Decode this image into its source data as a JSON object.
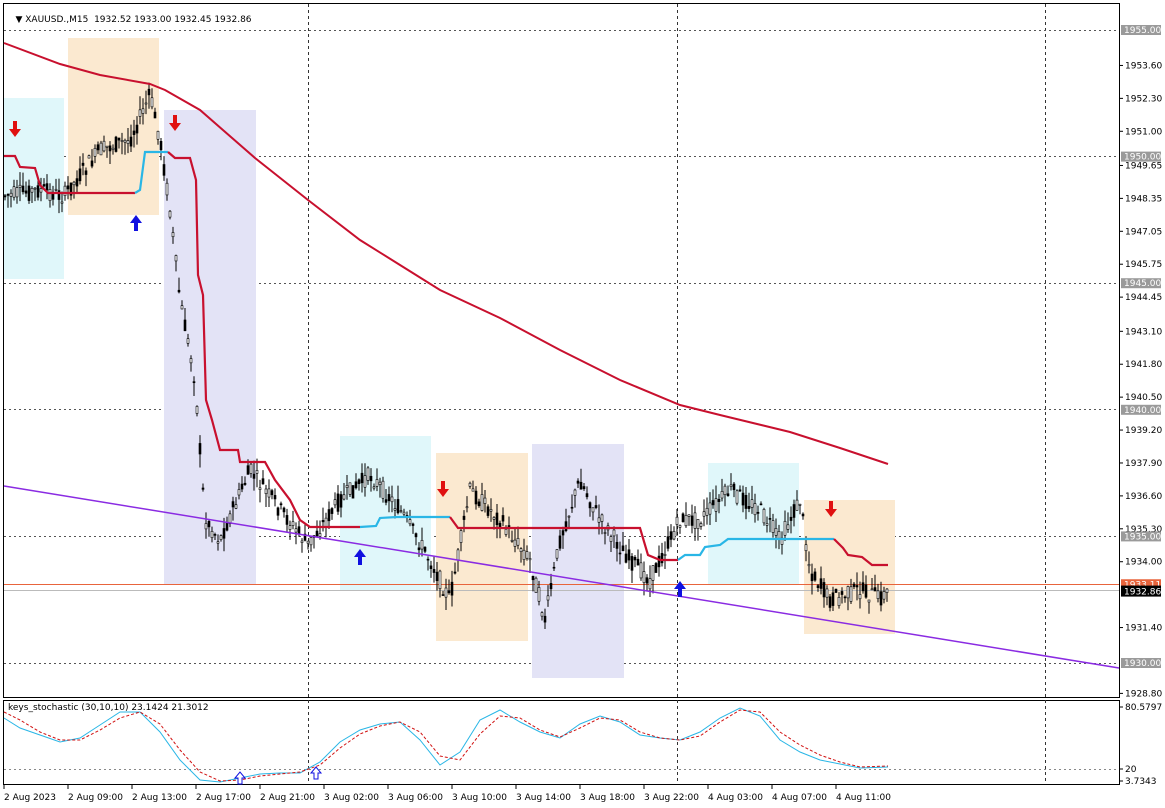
{
  "header": {
    "symbol": "XAUUSD.,M15",
    "ohlc": "1932.52 1933.00 1932.45 1932.86"
  },
  "indicator": {
    "label": "keys_stochastic (30,10,10) 23.1424 21.3012"
  },
  "price_scale": {
    "labels": [
      "1953.60",
      "1952.30",
      "1951.00",
      "1949.65",
      "1948.35",
      "1947.05",
      "1945.75",
      "1944.45",
      "1943.10",
      "1941.80",
      "1940.50",
      "1939.20",
      "1937.90",
      "1936.60",
      "1935.30",
      "1934.00",
      "1931.40",
      "1928.80"
    ],
    "grid_levels": [
      "1955.00",
      "1950.00",
      "1945.00",
      "1940.00",
      "1935.00",
      "1930.00"
    ],
    "current_price": "1932.86",
    "line_price": "1933.11"
  },
  "indicator_scale": {
    "top": "80.5797",
    "level": "20",
    "bottom": "3.7343"
  },
  "time_axis": {
    "labels": [
      "2 Aug 2023",
      "2 Aug 09:00",
      "2 Aug 13:00",
      "2 Aug 17:00",
      "2 Aug 21:00",
      "3 Aug 02:00",
      "3 Aug 06:00",
      "3 Aug 10:00",
      "3 Aug 14:00",
      "3 Aug 18:00",
      "3 Aug 22:00",
      "4 Aug 03:00",
      "4 Aug 07:00",
      "4 Aug 11:00"
    ]
  },
  "colors": {
    "bull_box": "#e0f7fa",
    "bear_box": "#fbe9d0",
    "neutral_box": "#e3e3f6",
    "ma_red": "#c8102e",
    "trend_cyan": "#29b6e6",
    "trend_purple": "#8a2be2",
    "stoch_cyan": "#29b6e6",
    "stoch_red": "#d01010",
    "price_line": "#e8643c"
  }
}
